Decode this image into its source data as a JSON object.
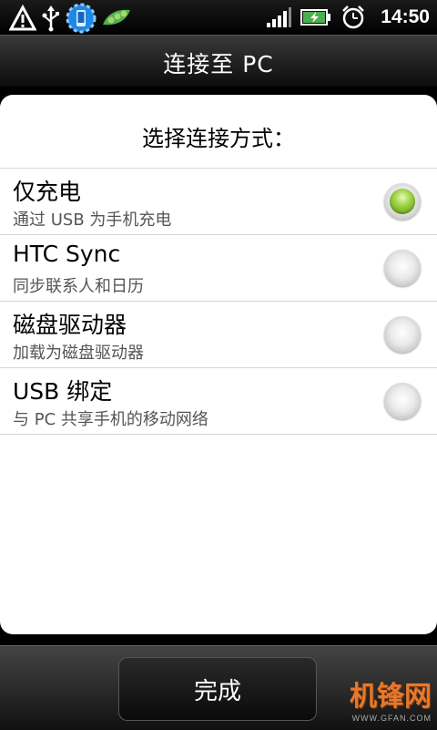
{
  "status_bar": {
    "icons_left": [
      "warning-icon",
      "usb-icon",
      "phone-settings-icon",
      "peapod-icon"
    ],
    "icons_right": [
      "signal-icon",
      "battery-charging-icon",
      "alarm-icon"
    ],
    "time": "14:50"
  },
  "header": {
    "title": "连接至 PC"
  },
  "dialog": {
    "prompt": "选择连接方式：",
    "options": [
      {
        "title": "仅充电",
        "subtitle": "通过 USB 为手机充电",
        "selected": true
      },
      {
        "title": "HTC Sync",
        "subtitle": "同步联系人和日历",
        "selected": false
      },
      {
        "title": "磁盘驱动器",
        "subtitle": "加载为磁盘驱动器",
        "selected": false
      },
      {
        "title": "USB 绑定",
        "subtitle": "与 PC 共享手机的移动网络",
        "selected": false
      }
    ]
  },
  "footer": {
    "done_label": "完成"
  },
  "watermark": {
    "main": "机锋网",
    "sub": "WWW.GFAN.COM"
  },
  "colors": {
    "radio_selected": "#8bc53f",
    "dialog_bg": "#ffffff",
    "bar_bg": "#222222"
  }
}
